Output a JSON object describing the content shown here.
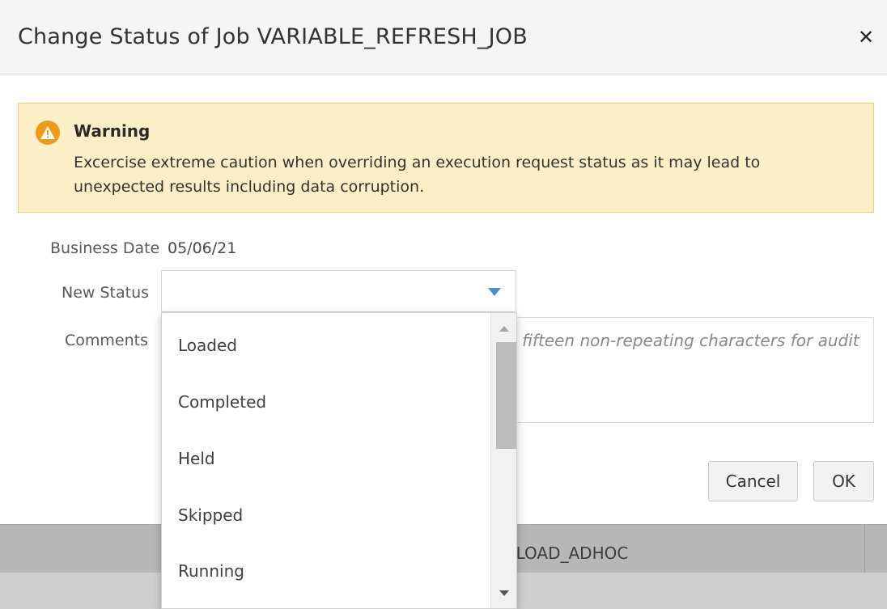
{
  "dialog": {
    "title": "Change Status of Job VARIABLE_REFRESH_JOB",
    "close_icon": "close-icon"
  },
  "warning": {
    "icon": "warning-icon",
    "title": "Warning",
    "message": "Excercise extreme caution when overriding an execution request status as it may lead to unexpected results including data corruption."
  },
  "form": {
    "business_date_label": "Business Date",
    "business_date_value": "05/06/21",
    "new_status_label": "New Status",
    "new_status_value": "",
    "comments_label": "Comments",
    "comments_placeholder": "fifteen non-repeating characters for audit"
  },
  "dropdown": {
    "options": [
      "Loaded",
      "Completed",
      "Held",
      "Skipped",
      "Running"
    ]
  },
  "buttons": {
    "cancel": "Cancel",
    "ok": "OK"
  },
  "background": {
    "row_text": "AR_LOAD_ADHOC"
  },
  "colors": {
    "warning_bg": "#fcefc7",
    "warning_border": "#f3cf74",
    "warning_icon": "#f09a1a",
    "select_arrow": "#4a90c9"
  }
}
